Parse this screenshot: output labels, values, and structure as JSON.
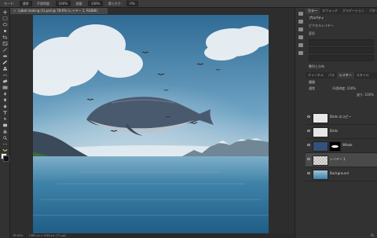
{
  "options_bar": {
    "items": [
      "モード:",
      "通常",
      "不透明度:",
      "100%",
      "流量:",
      "100%",
      "滑らかさ:",
      "0%"
    ]
  },
  "document_tab": {
    "title": "Label making (1).psd @ 78.6% (レイヤー 1, RGB/8)",
    "close_glyph": "×"
  },
  "status_bar": {
    "zoom": "78.64%",
    "info": "1080 px x 1080 px (72 ppi)"
  },
  "panel_tabs_top": [
    "カラー",
    "スウォッチ",
    "グラデーション",
    "パターン"
  ],
  "properties": {
    "title": "プロパティ",
    "subtitle": "ピクセルレイヤー",
    "section": "変形",
    "align_label": "整列と分布"
  },
  "layers_tabs": [
    "チャンネル",
    "パス",
    "レイヤー",
    "スタイル"
  ],
  "layers_kind": "種類",
  "layers_mode": "通常",
  "layers_opacity": "不透明度: 100%",
  "layers_fill": "塗り: 100%",
  "layers": [
    {
      "name": "Birds のコピー",
      "thumb_color": "#e8e8e8",
      "selected": false,
      "mask": false
    },
    {
      "name": "Birds",
      "thumb_color": "#e6e6e6",
      "selected": false,
      "mask": false
    },
    {
      "name": "Whale",
      "thumb_color": "#35507a",
      "selected": false,
      "mask": true
    },
    {
      "name": "レイヤー 1",
      "thumb_color": "checker",
      "selected": true,
      "mask": false
    },
    {
      "name": "Background",
      "thumb_color": "#7fb0cf",
      "selected": false,
      "mask": false
    }
  ],
  "footer": "fx",
  "colors": {
    "ui_dark": "#262626",
    "panel": "#323232",
    "sky_top": "#3f7aa6",
    "sea": "#2f6f94",
    "selected_layer": "#4a4a4a"
  }
}
